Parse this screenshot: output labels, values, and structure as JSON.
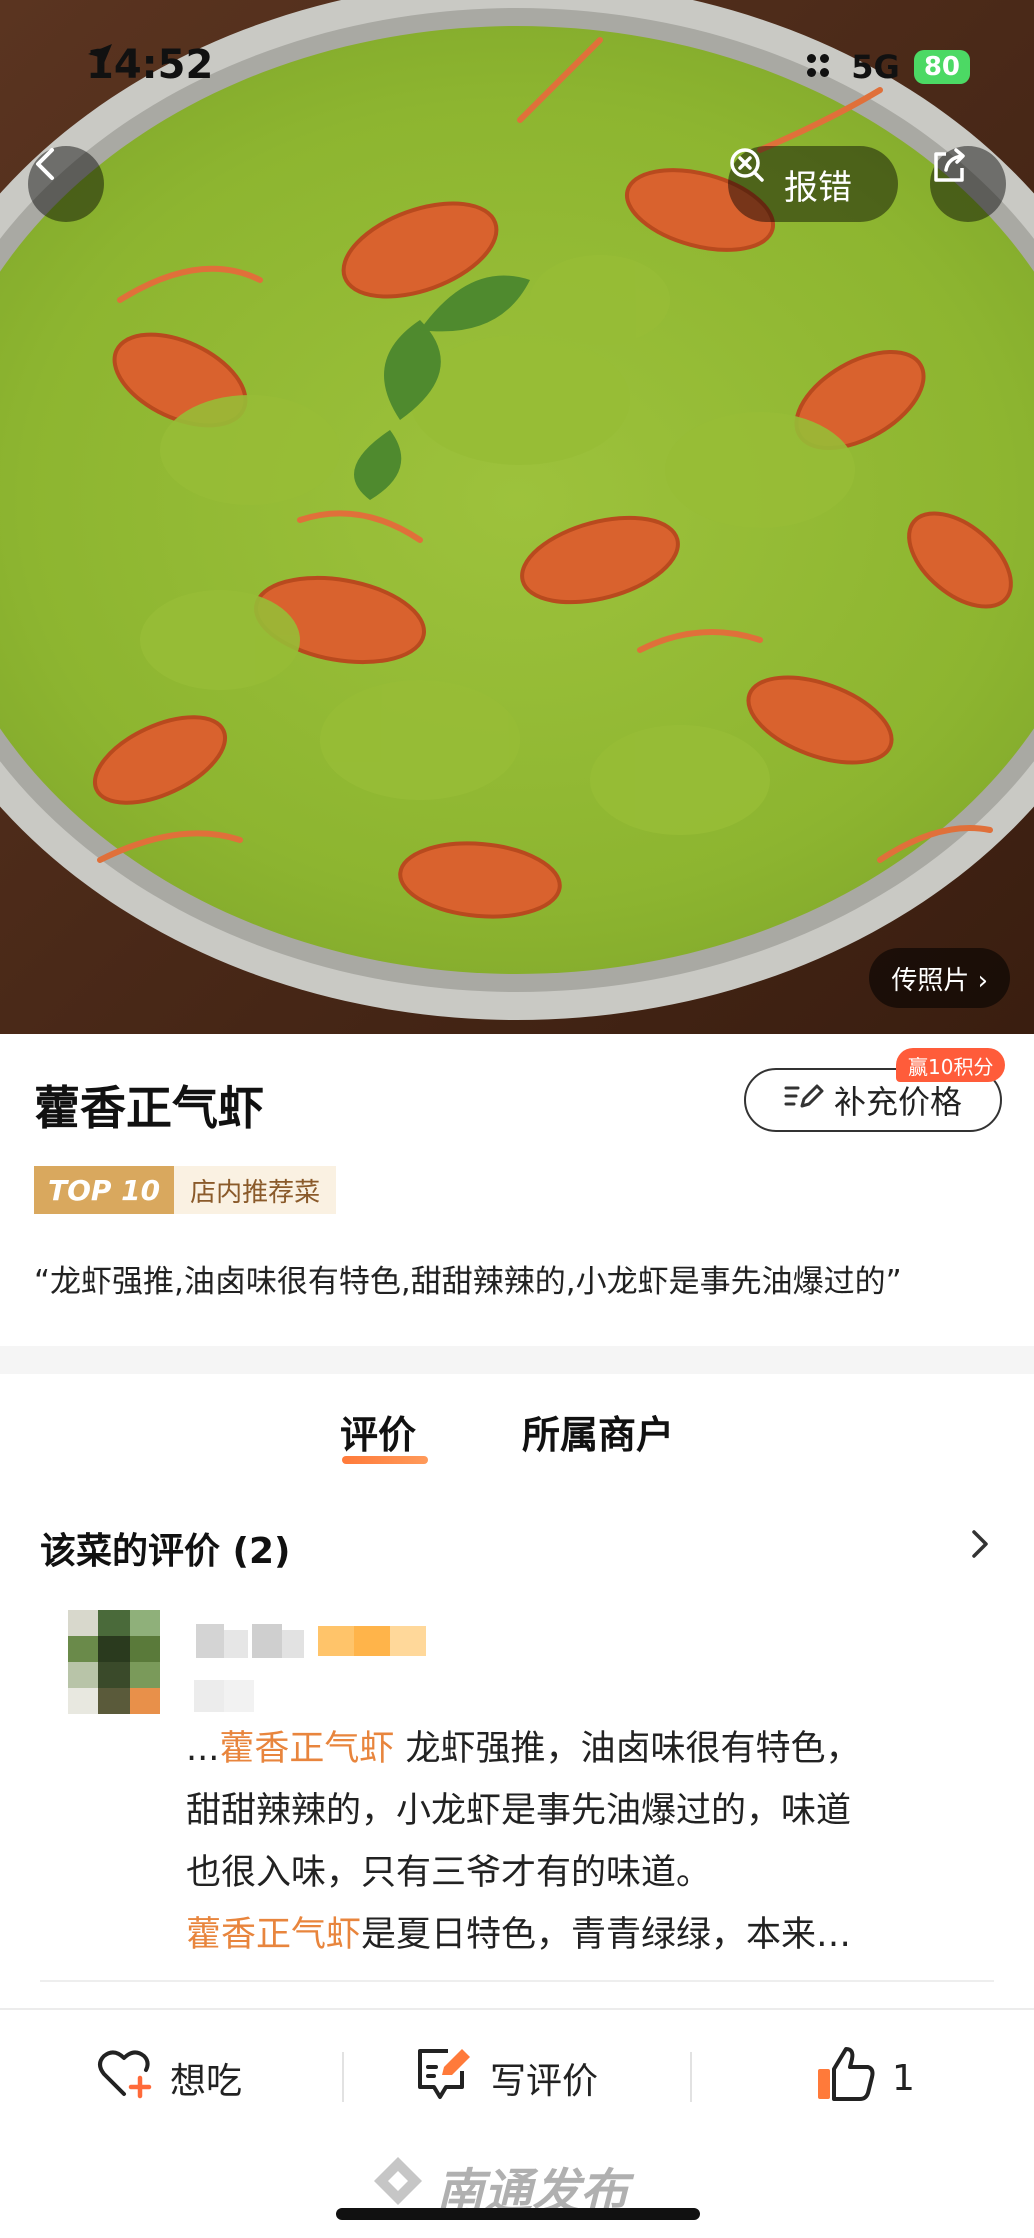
{
  "status_bar": {
    "time": "14:52",
    "network": "5G",
    "battery": "80"
  },
  "header": {
    "report_label": "报错",
    "upload_photo_label": "传照片 ›"
  },
  "dish": {
    "name": "藿香正气虾",
    "add_price_label": "补充价格",
    "points_badge": "赢10积分",
    "tag_top": "TOP 10",
    "tag_label": "店内推荐菜",
    "quote": "“龙虾强推,油卤味很有特色,甜甜辣辣的,小龙虾是事先油爆过的”"
  },
  "tabs": [
    {
      "label": "评价",
      "active": true
    },
    {
      "label": "所属商户",
      "active": false
    }
  ],
  "reviews": {
    "title": "该菜的评价 (2)",
    "items": [
      {
        "line1_prefix": "...",
        "line1_highlight": "藿香正气虾",
        "line1_rest": " 龙虾强推，油卤味很有特色，",
        "line2": "甜甜辣辣的，小龙虾是事先油爆过的，味道",
        "line3": "也很入味，只有三爷才有的味道。",
        "line4_highlight": "藿香正气虾",
        "line4_rest": "是夏日特色，青青绿绿，本来…"
      }
    ]
  },
  "bottom_bar": {
    "want_label": "想吃",
    "write_label": "写评价",
    "like_count": "1"
  },
  "watermark": "南通发布",
  "colors": {
    "accent": "#e8853d",
    "badge": "#ff5c3a",
    "tag_gold": "#d9a85e"
  },
  "icons": [
    "location-arrow-icon",
    "back-arrow-icon",
    "report-icon",
    "share-icon",
    "edit-price-icon",
    "chevron-right-icon",
    "heart-plus-icon",
    "write-review-icon",
    "thumbs-up-icon"
  ]
}
